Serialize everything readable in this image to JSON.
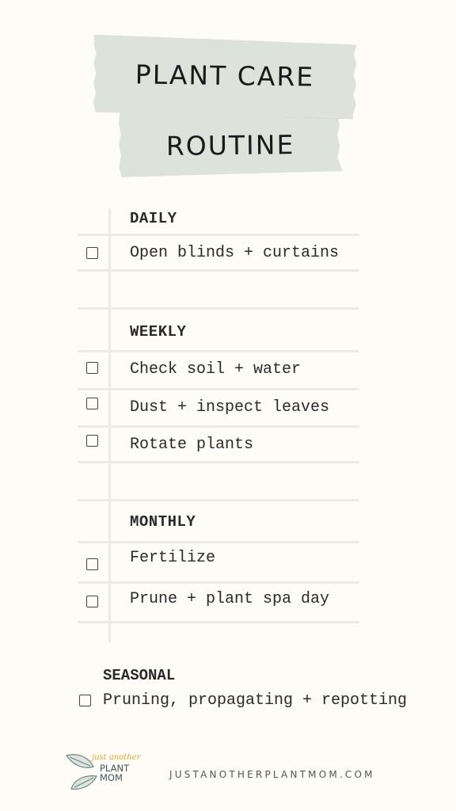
{
  "title": {
    "line1": "PLANT CARE",
    "line2": "ROUTINE"
  },
  "sections": [
    {
      "heading": "DAILY",
      "items": [
        {
          "label": "Open blinds + curtains",
          "checked": false
        }
      ]
    },
    {
      "heading": "WEEKLY",
      "items": [
        {
          "label": "Check soil + water",
          "checked": false
        },
        {
          "label": "Dust + inspect leaves",
          "checked": false
        },
        {
          "label": "Rotate plants",
          "checked": false
        }
      ]
    },
    {
      "heading": "MONTHLY",
      "items": [
        {
          "label": "Fertilize",
          "checked": false
        },
        {
          "label": "Prune + plant spa day",
          "checked": false
        }
      ]
    },
    {
      "heading": "SEASONAL",
      "items": [
        {
          "label": "Pruning, propagating + repotting",
          "checked": false
        }
      ]
    }
  ],
  "footer": {
    "logo_script": "just another",
    "logo_line1": "PLANT",
    "logo_line2": "MOM",
    "website": "JUSTANOTHERPLANTMOM.COM"
  },
  "colors": {
    "background": "#fdfcf7",
    "tape": "#dde3db",
    "rule_lines": "#ecebe6",
    "logo_accent": "#e0a82e",
    "logo_text": "#3b5a5a"
  }
}
